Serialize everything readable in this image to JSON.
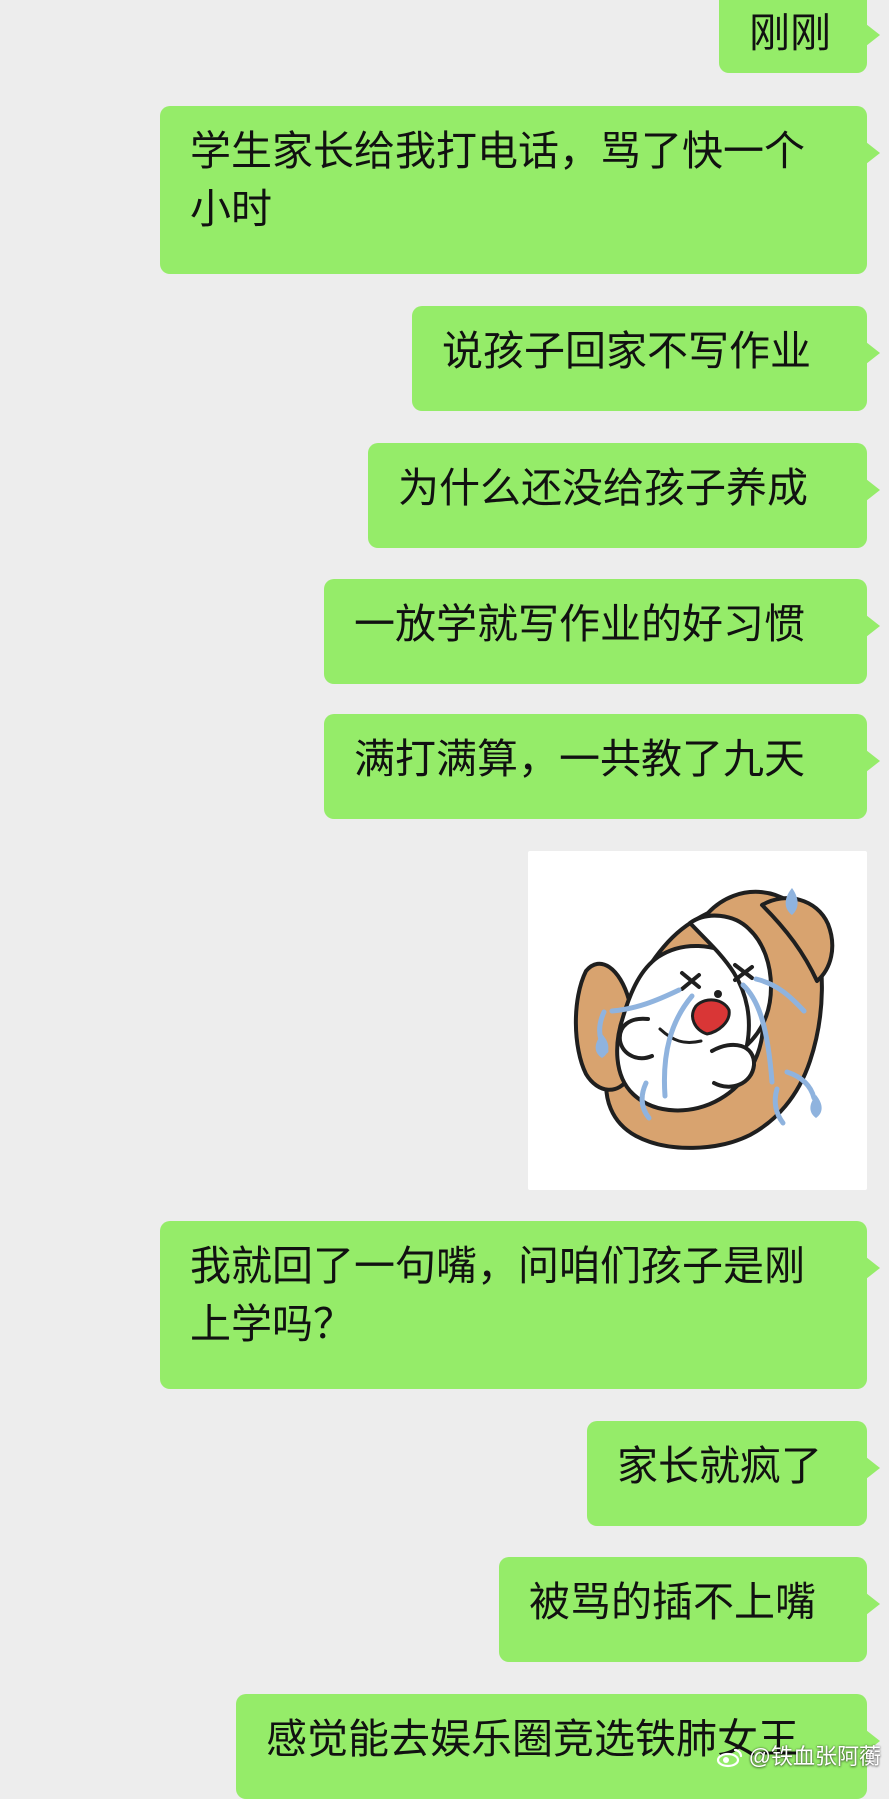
{
  "messages": [
    {
      "text": "刚刚"
    },
    {
      "text": "学生家长给我打电话，骂了快一个小时"
    },
    {
      "text": "说孩子回家不写作业"
    },
    {
      "text": "为什么还没给孩子养成"
    },
    {
      "text": "一放学就写作业的好习惯"
    },
    {
      "text": "满打满算，一共教了九天"
    },
    {
      "text": "我就回了一句嘴，问咱们孩子是刚上学吗？"
    },
    {
      "text": "家长就疯了"
    },
    {
      "text": "被骂的插不上嘴"
    },
    {
      "text": "感觉能去娱乐圈竞选铁肺女王"
    }
  ],
  "sticker": {
    "description": "crying puppy sticker"
  },
  "watermark": {
    "text": "@铁血张阿蘅"
  },
  "colors": {
    "background": "#ededed",
    "outgoing_bubble": "#95ec69",
    "text": "#111111",
    "watermark": "#ffffff"
  }
}
